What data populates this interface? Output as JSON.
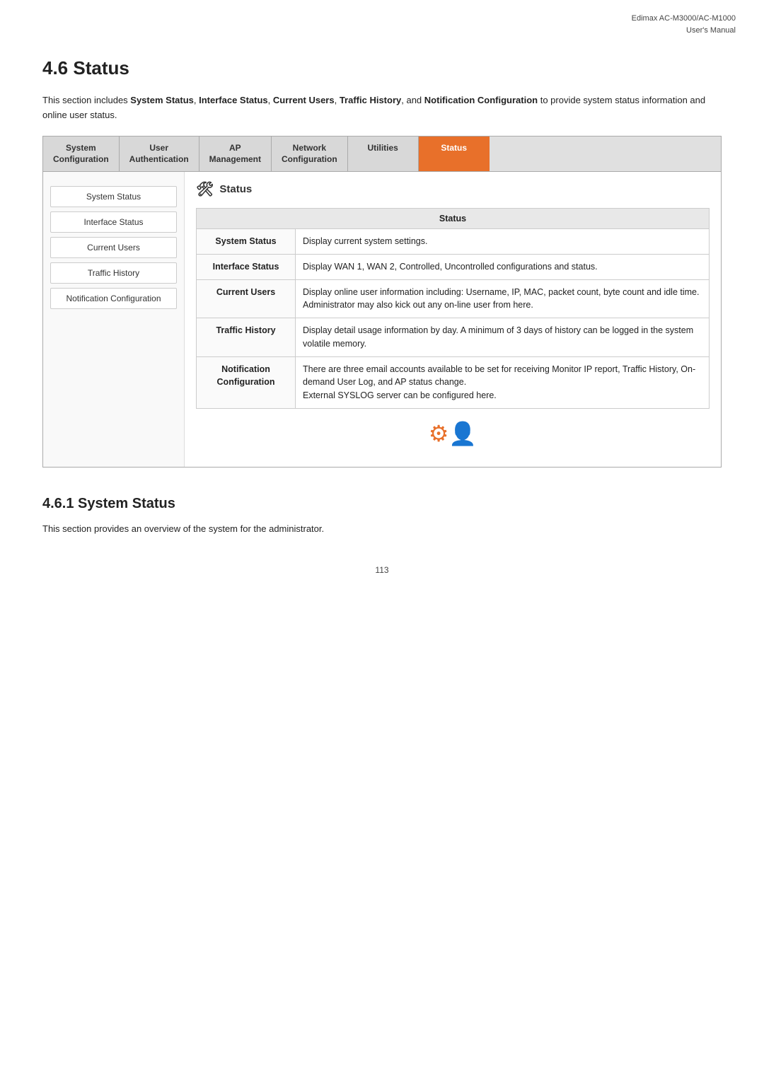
{
  "header": {
    "line1": "Edimax  AC-M3000/AC-M1000",
    "line2": "User's  Manual"
  },
  "section": {
    "title": "4.6 Status",
    "intro": "This section includes ",
    "intro_terms": [
      "System Status",
      "Interface Status",
      "Current Users",
      "Traffic History",
      "Notification Configuration"
    ],
    "intro_suffix": " to provide system status information and online user status."
  },
  "nav_tabs": [
    {
      "label": "System\nConfiguration",
      "active": false
    },
    {
      "label": "User\nAuthentication",
      "active": false
    },
    {
      "label": "AP\nManagement",
      "active": false
    },
    {
      "label": "Network\nConfiguration",
      "active": false
    },
    {
      "label": "Utilities",
      "active": false
    },
    {
      "label": "Status",
      "active": true
    }
  ],
  "sidebar": {
    "items": [
      {
        "label": "System Status",
        "active": false
      },
      {
        "label": "Interface Status",
        "active": false
      },
      {
        "label": "Current Users",
        "active": false
      },
      {
        "label": "Traffic History",
        "active": false
      },
      {
        "label": "Notification Configuration",
        "active": false
      }
    ]
  },
  "main": {
    "title": "Status",
    "table_header": "Status",
    "rows": [
      {
        "name": "System Status",
        "desc": "Display current system settings."
      },
      {
        "name": "Interface Status",
        "desc": "Display WAN 1, WAN 2, Controlled, Uncontrolled configurations and status."
      },
      {
        "name": "Current Users",
        "desc": "Display online user information including: Username, IP, MAC, packet count, byte count and idle time. Administrator may also kick out any on-line user from here."
      },
      {
        "name": "Traffic History",
        "desc": "Display detail usage information by day. A minimum of 3 days of history can be logged in the system volatile memory."
      },
      {
        "name": "Notification\nConfiguration",
        "desc": "There are three email accounts available to be set for receiving Monitor IP report, Traffic History, On-demand User Log, and AP status change.\nExternal SYSLOG server can be configured here."
      }
    ]
  },
  "subsection": {
    "title": "4.6.1 System Status",
    "text": "This section provides an overview of the system for the administrator."
  },
  "page_number": "113"
}
